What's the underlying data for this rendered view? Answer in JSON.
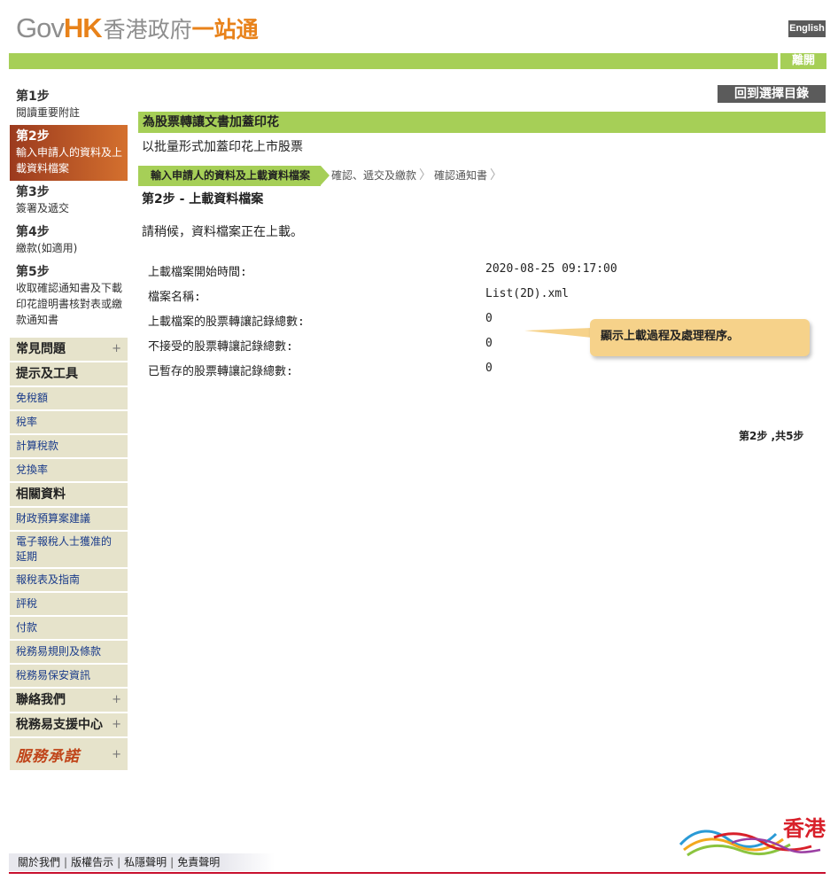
{
  "header": {
    "logo_gov": "Gov",
    "logo_hk": "HK",
    "logo_zh": "香港政府",
    "logo_zh2": "一站通",
    "lang_button": "English",
    "logout_button": "離開"
  },
  "sidebar": {
    "steps": [
      {
        "title": "第1步",
        "sub": "閱讀重要附註",
        "active": false
      },
      {
        "title": "第2步",
        "sub": "輸入申請人的資料及上載資料檔案",
        "active": true
      },
      {
        "title": "第3步",
        "sub": "簽署及遞交",
        "active": false
      },
      {
        "title": "第4步",
        "sub": "繳款(如適用)",
        "active": false
      },
      {
        "title": "第5步",
        "sub": "收取確認通知書及下載印花證明書核對表或繳款通知書",
        "active": false
      }
    ],
    "faq": "常見問題",
    "tips_heading": "提示及工具",
    "tips": [
      "免稅額",
      "稅率",
      "計算稅款",
      "兌換率"
    ],
    "related_heading": "相關資料",
    "related": [
      "財政預算案建議",
      "電子報稅人士獲准的延期",
      "報稅表及指南",
      "評稅",
      "付款",
      "稅務易規則及條款",
      "稅務易保安資訊"
    ],
    "contact": "聯絡我們",
    "support": "稅務易支援中心",
    "service_pledge": "服務承諾",
    "plus": "+"
  },
  "main": {
    "back_button": "回到選擇目錄",
    "title": "為股票轉讓文書加蓋印花",
    "subtitle": "以批量形式加蓋印花上市股票",
    "breadcrumb": [
      "輸入申請人的資料及上載資料檔案",
      "確認、遞交及繳款",
      "確認通知書"
    ],
    "step_heading": "第2步 - 上載資料檔案",
    "wait_message": "請稍候，資料檔案正在上載。",
    "info": [
      {
        "label": "上載檔案開始時間:",
        "value": "2020-08-25 09:17:00"
      },
      {
        "label": "檔案名稱:",
        "value": "List(2D).xml"
      },
      {
        "label": "上載檔案的股票轉讓記錄總數:",
        "value": "0"
      },
      {
        "label": "不接受的股票轉讓記錄總數:",
        "value": "0"
      },
      {
        "label": "已暫存的股票轉讓記錄總數:",
        "value": "0"
      }
    ],
    "callout": "顯示上載過程及處理程序。",
    "step_count": "第2步 ,共5步"
  },
  "footer": {
    "links": [
      "關於我們",
      "版權告示",
      "私隱聲明",
      "免責聲明"
    ],
    "brand": "香港"
  },
  "colors": {
    "green": "#a6cf57",
    "orange": "#e8821a",
    "active_step": "#c0551e",
    "nav_bg": "#e6e3cb",
    "callout": "#f6d28a"
  }
}
